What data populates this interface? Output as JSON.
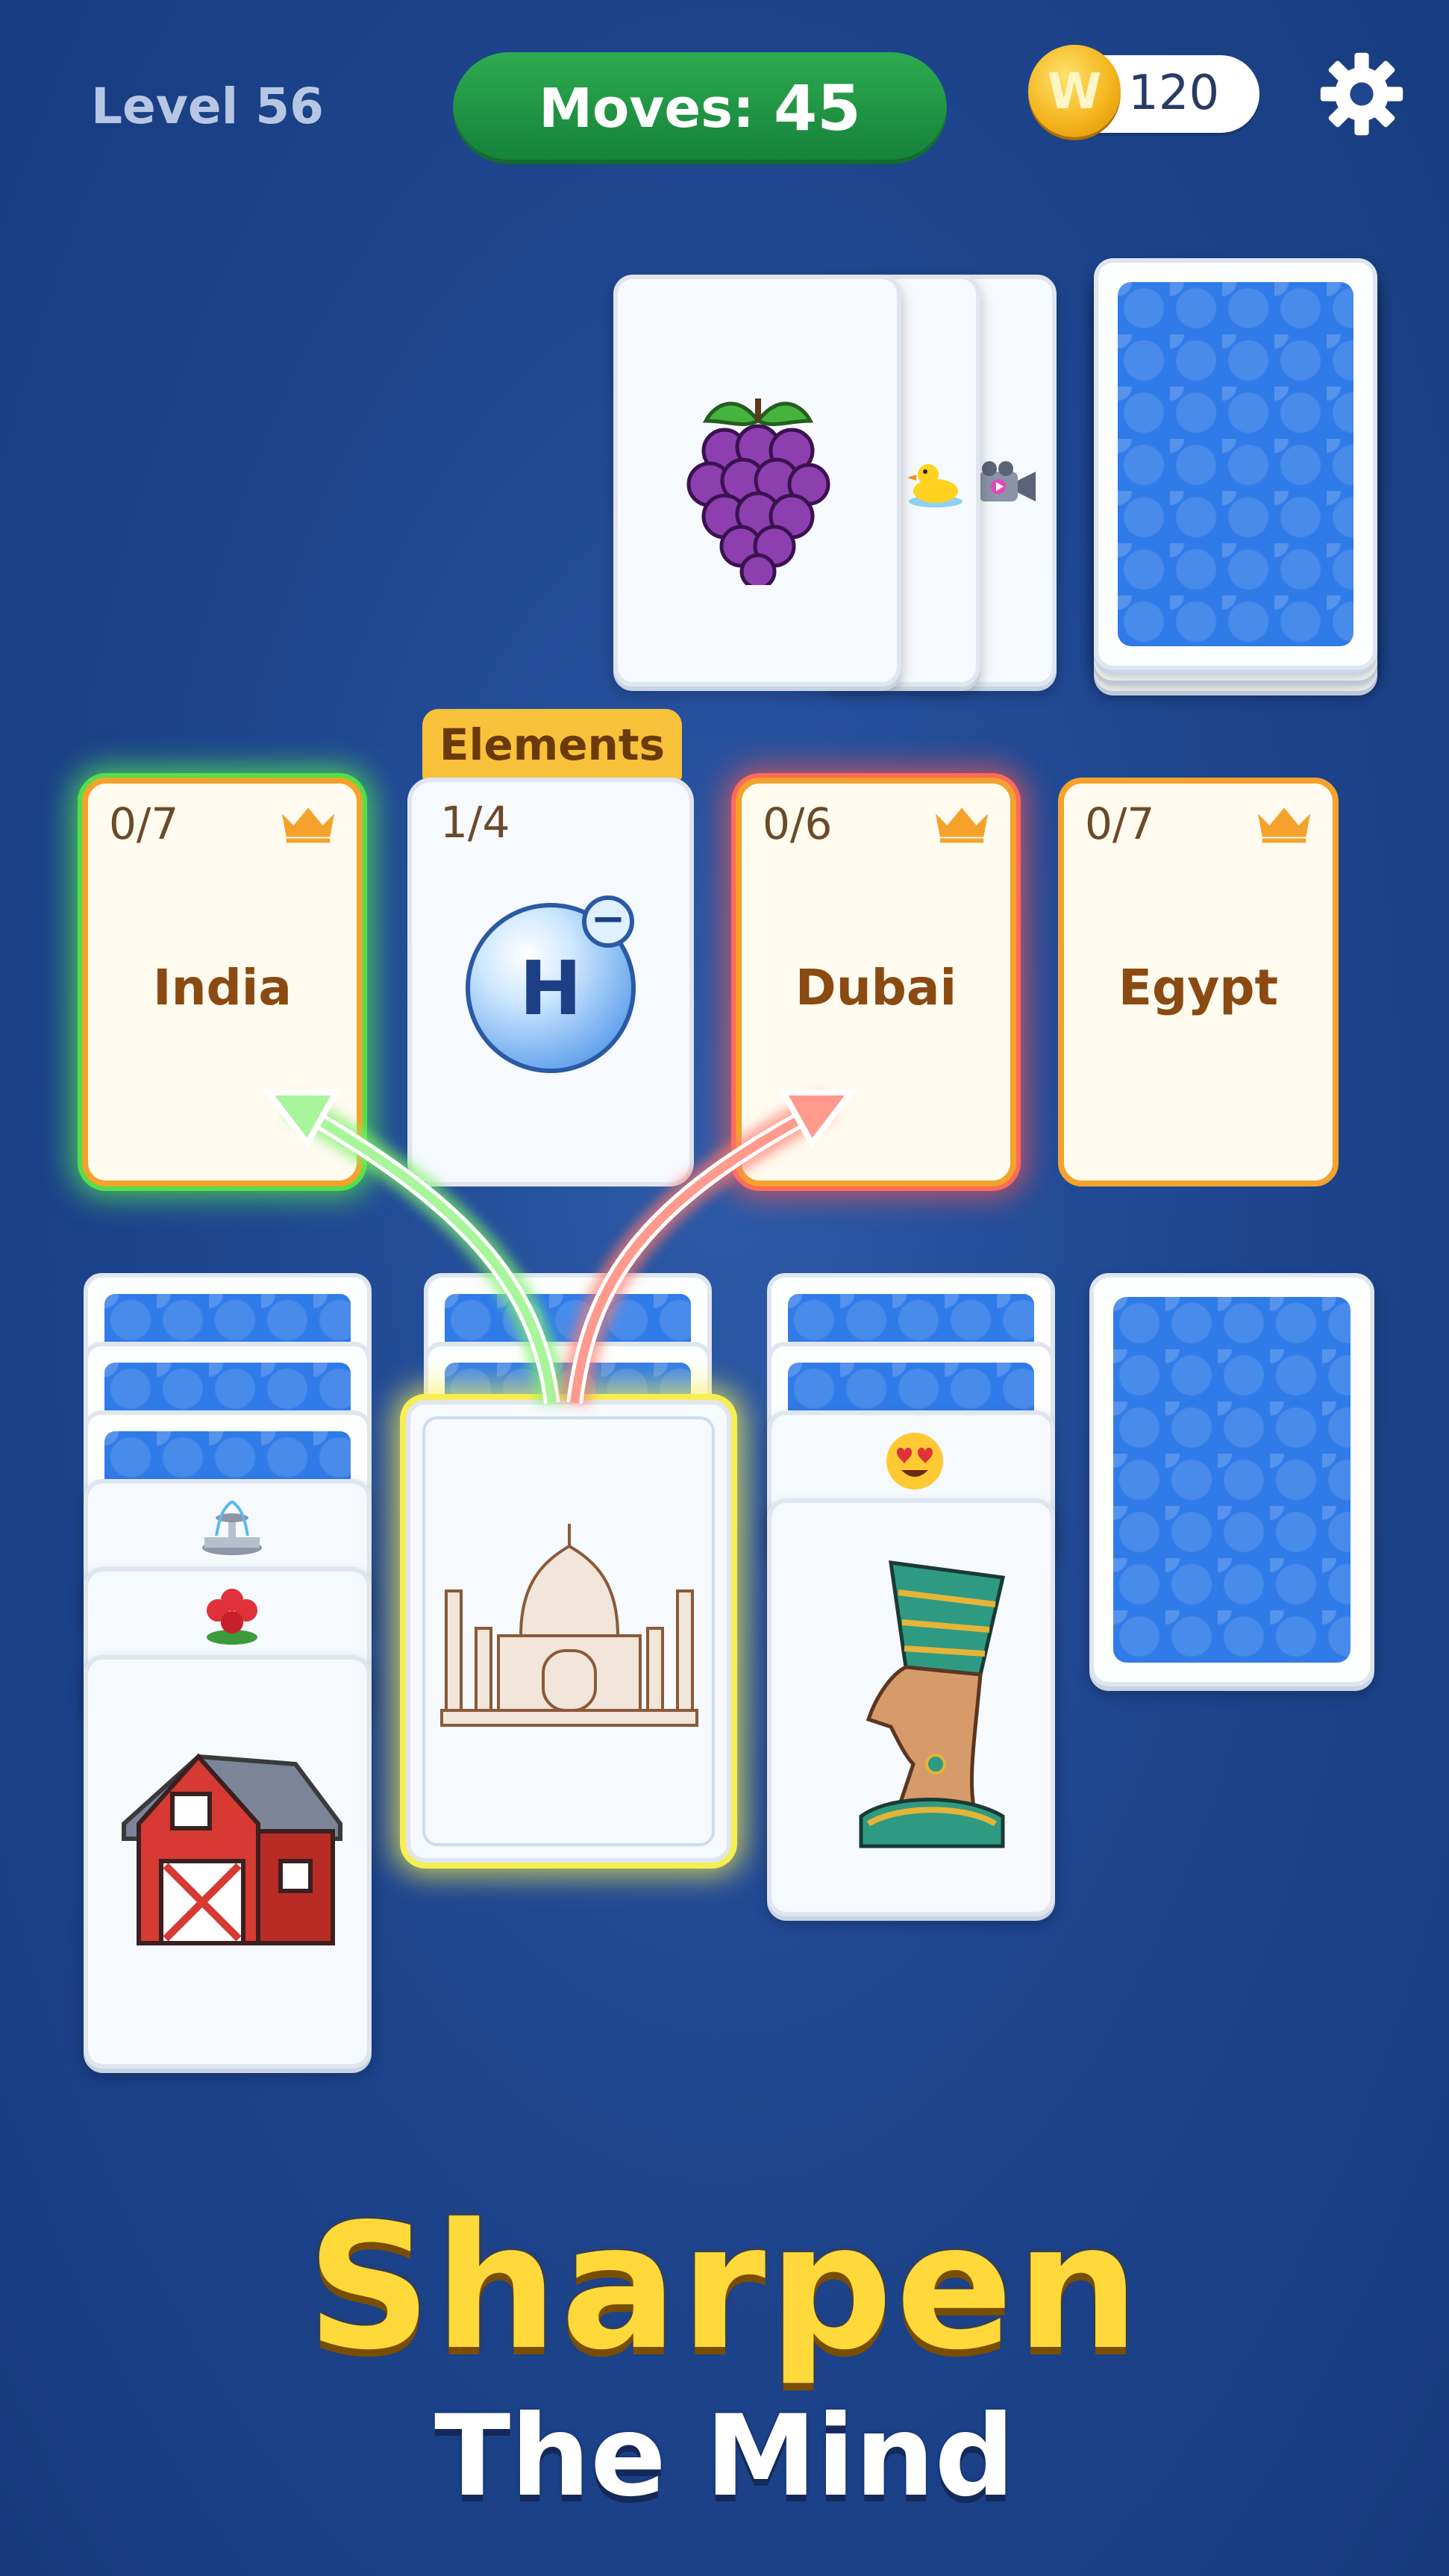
{
  "hud": {
    "level": "Level 56",
    "moves_label": "Moves:",
    "moves_value": "45",
    "coins": "120",
    "coin_symbol": "W"
  },
  "icons": {
    "settings": "gear-icon",
    "coin": "coin-icon",
    "crown": "crown-icon"
  },
  "categories": [
    {
      "name": "India",
      "progress": "0/7",
      "glow": "#52e04a"
    },
    {
      "name": "Elements",
      "progress": "1/4",
      "symbol": "H",
      "charge": "−"
    },
    {
      "name": "Dubai",
      "progress": "0/6",
      "glow": "#ff6a5a"
    },
    {
      "name": "Egypt",
      "progress": "0/7"
    }
  ],
  "cards": {
    "draw_pile": [
      "grapes",
      "rubber-duck",
      "movie-camera"
    ],
    "column_1": [
      "fountain",
      "roses",
      "barn"
    ],
    "column_2_selected": "taj-mahal",
    "column_3": [
      "heart-eyes",
      "nefertiti"
    ]
  },
  "headline": {
    "line1": "Sharpen",
    "line2": "The Mind"
  },
  "colors": {
    "background": "#1f4690",
    "moves_pill": "#1d9a45",
    "category_border": "#f4a22c",
    "headline_yellow": "#ffd83a"
  }
}
